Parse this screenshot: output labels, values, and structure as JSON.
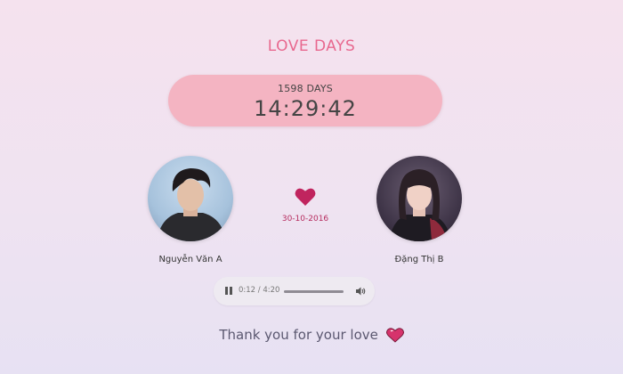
{
  "title": "LOVE DAYS",
  "counter": {
    "days": "1598 DAYS",
    "time": "14:29:42"
  },
  "person_left": {
    "name": "Nguyễn Văn A"
  },
  "person_right": {
    "name": "Đặng Thị B"
  },
  "date": "30-10-2016",
  "audio": {
    "time": "0:12 / 4:20",
    "progress": 0.046
  },
  "footer": {
    "message": "Thank you for your love"
  },
  "colors": {
    "accent": "#e8698f",
    "counter_bg": "#f4b4c2",
    "heart": "#c0245e",
    "date": "#b62d5f"
  },
  "icons": {
    "main_heart": "heart-icon",
    "pause": "pause-icon",
    "volume": "volume-icon",
    "footer_heart": "heart-emoji-icon"
  }
}
